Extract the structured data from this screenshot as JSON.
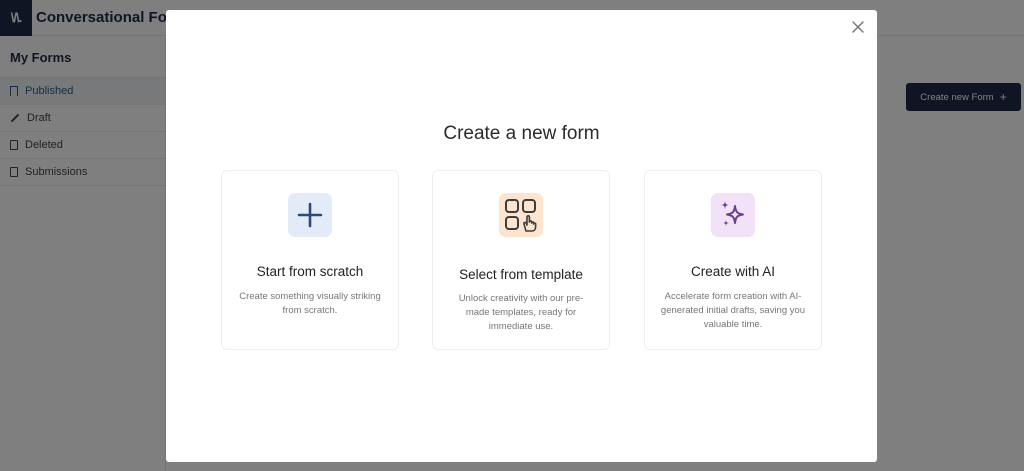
{
  "app": {
    "logo_text": "\\/\\.",
    "title": "Conversational Form",
    "create_button": {
      "label": "Create new Form",
      "icon": "plus-icon"
    }
  },
  "sidebar": {
    "heading": "My Forms",
    "items": [
      {
        "label": "Published",
        "icon": "bookmark-icon",
        "active": true
      },
      {
        "label": "Draft",
        "icon": "pencil-icon"
      },
      {
        "label": "Deleted",
        "icon": "trash-icon"
      },
      {
        "label": "Submissions",
        "icon": "document-icon"
      }
    ]
  },
  "modal": {
    "title": "Create a new form",
    "close_icon": "close-icon",
    "options": [
      {
        "title": "Start from scratch",
        "description": "Create something visually striking from scratch.",
        "icon": "plus-icon",
        "icon_bg": "#e3ebf8",
        "icon_color": "#2f4a77"
      },
      {
        "title": "Select from template",
        "description": "Unlock creativity with our pre-made templates, ready for immediate use.",
        "icon": "template-grid-icon",
        "icon_bg": "#fde4cf",
        "icon_color": "#3d3d3d"
      },
      {
        "title": "Create with AI",
        "description": "Accelerate form creation with AI-generated initial drafts, saving you valuable time.",
        "icon": "sparkles-icon",
        "icon_bg": "#f1e2f8",
        "icon_color": "#6a3d8f"
      }
    ]
  },
  "colors": {
    "brand_dark": "#1f2a44",
    "overlay": "rgba(0,0,0,0.5)",
    "active_text": "#2e5f8a"
  }
}
